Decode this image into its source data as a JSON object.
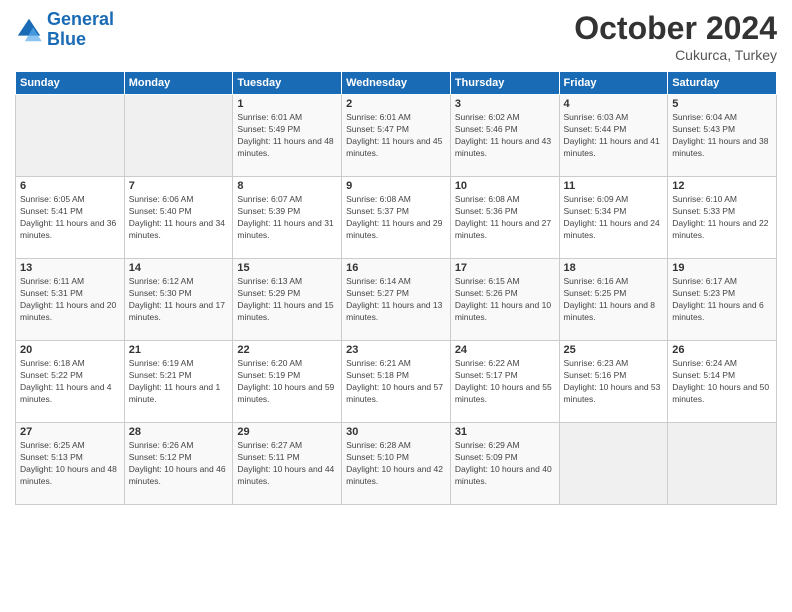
{
  "header": {
    "logo_line1": "General",
    "logo_line2": "Blue",
    "month": "October 2024",
    "location": "Cukurca, Turkey"
  },
  "weekdays": [
    "Sunday",
    "Monday",
    "Tuesday",
    "Wednesday",
    "Thursday",
    "Friday",
    "Saturday"
  ],
  "weeks": [
    [
      {
        "day": "",
        "empty": true
      },
      {
        "day": "",
        "empty": true
      },
      {
        "day": "1",
        "sunrise": "6:01 AM",
        "sunset": "5:49 PM",
        "daylight": "11 hours and 48 minutes."
      },
      {
        "day": "2",
        "sunrise": "6:01 AM",
        "sunset": "5:47 PM",
        "daylight": "11 hours and 45 minutes."
      },
      {
        "day": "3",
        "sunrise": "6:02 AM",
        "sunset": "5:46 PM",
        "daylight": "11 hours and 43 minutes."
      },
      {
        "day": "4",
        "sunrise": "6:03 AM",
        "sunset": "5:44 PM",
        "daylight": "11 hours and 41 minutes."
      },
      {
        "day": "5",
        "sunrise": "6:04 AM",
        "sunset": "5:43 PM",
        "daylight": "11 hours and 38 minutes."
      }
    ],
    [
      {
        "day": "6",
        "sunrise": "6:05 AM",
        "sunset": "5:41 PM",
        "daylight": "11 hours and 36 minutes."
      },
      {
        "day": "7",
        "sunrise": "6:06 AM",
        "sunset": "5:40 PM",
        "daylight": "11 hours and 34 minutes."
      },
      {
        "day": "8",
        "sunrise": "6:07 AM",
        "sunset": "5:39 PM",
        "daylight": "11 hours and 31 minutes."
      },
      {
        "day": "9",
        "sunrise": "6:08 AM",
        "sunset": "5:37 PM",
        "daylight": "11 hours and 29 minutes."
      },
      {
        "day": "10",
        "sunrise": "6:08 AM",
        "sunset": "5:36 PM",
        "daylight": "11 hours and 27 minutes."
      },
      {
        "day": "11",
        "sunrise": "6:09 AM",
        "sunset": "5:34 PM",
        "daylight": "11 hours and 24 minutes."
      },
      {
        "day": "12",
        "sunrise": "6:10 AM",
        "sunset": "5:33 PM",
        "daylight": "11 hours and 22 minutes."
      }
    ],
    [
      {
        "day": "13",
        "sunrise": "6:11 AM",
        "sunset": "5:31 PM",
        "daylight": "11 hours and 20 minutes."
      },
      {
        "day": "14",
        "sunrise": "6:12 AM",
        "sunset": "5:30 PM",
        "daylight": "11 hours and 17 minutes."
      },
      {
        "day": "15",
        "sunrise": "6:13 AM",
        "sunset": "5:29 PM",
        "daylight": "11 hours and 15 minutes."
      },
      {
        "day": "16",
        "sunrise": "6:14 AM",
        "sunset": "5:27 PM",
        "daylight": "11 hours and 13 minutes."
      },
      {
        "day": "17",
        "sunrise": "6:15 AM",
        "sunset": "5:26 PM",
        "daylight": "11 hours and 10 minutes."
      },
      {
        "day": "18",
        "sunrise": "6:16 AM",
        "sunset": "5:25 PM",
        "daylight": "11 hours and 8 minutes."
      },
      {
        "day": "19",
        "sunrise": "6:17 AM",
        "sunset": "5:23 PM",
        "daylight": "11 hours and 6 minutes."
      }
    ],
    [
      {
        "day": "20",
        "sunrise": "6:18 AM",
        "sunset": "5:22 PM",
        "daylight": "11 hours and 4 minutes."
      },
      {
        "day": "21",
        "sunrise": "6:19 AM",
        "sunset": "5:21 PM",
        "daylight": "11 hours and 1 minute."
      },
      {
        "day": "22",
        "sunrise": "6:20 AM",
        "sunset": "5:19 PM",
        "daylight": "10 hours and 59 minutes."
      },
      {
        "day": "23",
        "sunrise": "6:21 AM",
        "sunset": "5:18 PM",
        "daylight": "10 hours and 57 minutes."
      },
      {
        "day": "24",
        "sunrise": "6:22 AM",
        "sunset": "5:17 PM",
        "daylight": "10 hours and 55 minutes."
      },
      {
        "day": "25",
        "sunrise": "6:23 AM",
        "sunset": "5:16 PM",
        "daylight": "10 hours and 53 minutes."
      },
      {
        "day": "26",
        "sunrise": "6:24 AM",
        "sunset": "5:14 PM",
        "daylight": "10 hours and 50 minutes."
      }
    ],
    [
      {
        "day": "27",
        "sunrise": "6:25 AM",
        "sunset": "5:13 PM",
        "daylight": "10 hours and 48 minutes."
      },
      {
        "day": "28",
        "sunrise": "6:26 AM",
        "sunset": "5:12 PM",
        "daylight": "10 hours and 46 minutes."
      },
      {
        "day": "29",
        "sunrise": "6:27 AM",
        "sunset": "5:11 PM",
        "daylight": "10 hours and 44 minutes."
      },
      {
        "day": "30",
        "sunrise": "6:28 AM",
        "sunset": "5:10 PM",
        "daylight": "10 hours and 42 minutes."
      },
      {
        "day": "31",
        "sunrise": "6:29 AM",
        "sunset": "5:09 PM",
        "daylight": "10 hours and 40 minutes."
      },
      {
        "day": "",
        "empty": true
      },
      {
        "day": "",
        "empty": true
      }
    ]
  ],
  "labels": {
    "sunrise": "Sunrise:",
    "sunset": "Sunset:",
    "daylight": "Daylight:"
  }
}
